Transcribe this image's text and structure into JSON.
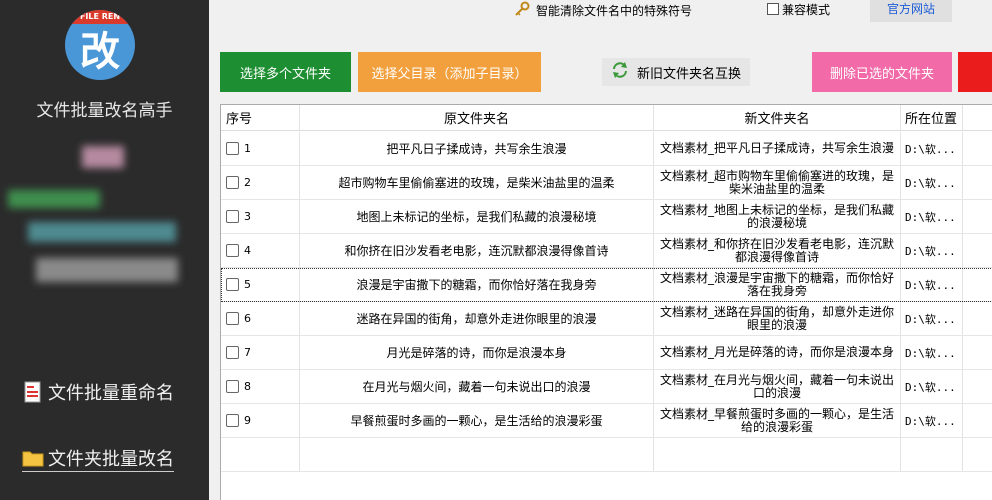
{
  "sidebar": {
    "logo_top_text": "FILE REN",
    "logo_char": "改",
    "app_title": "文件批量改名高手",
    "nav_rename": "文件批量重命名",
    "nav_folder": "文件夹批量改名"
  },
  "topbar": {
    "clear_special": "智能清除文件名中的特殊符号",
    "compat_mode": "兼容模式",
    "official_site": "官方网站"
  },
  "buttons": {
    "select_multi": "选择多个文件夹",
    "select_parent": "选择父目录（添加子目录）",
    "swap": "新旧文件夹名互换",
    "delete_selected": "删除已选的文件夹"
  },
  "table": {
    "headers": [
      "序号",
      "原文件夹名",
      "新文件夹名",
      "所在位置"
    ],
    "rows": [
      {
        "idx": "1",
        "orig": "把平凡日子揉成诗，共写余生浪漫",
        "new": "文档素材_把平凡日子揉成诗，共写余生浪漫",
        "loc": "D:\\软..."
      },
      {
        "idx": "2",
        "orig": "超市购物车里偷偷塞进的玫瑰，是柴米油盐里的温柔",
        "new": "文档素材_超市购物车里偷偷塞进的玫瑰，是柴米油盐里的温柔",
        "loc": "D:\\软..."
      },
      {
        "idx": "3",
        "orig": "地图上未标记的坐标，是我们私藏的浪漫秘境",
        "new": "文档素材_地图上未标记的坐标，是我们私藏的浪漫秘境",
        "loc": "D:\\软..."
      },
      {
        "idx": "4",
        "orig": "和你挤在旧沙发看老电影，连沉默都浪漫得像首诗",
        "new": "文档素材_和你挤在旧沙发看老电影，连沉默都浪漫得像首诗",
        "loc": "D:\\软..."
      },
      {
        "idx": "5",
        "orig": "浪漫是宇宙撒下的糖霜，而你恰好落在我身旁",
        "new": "文档素材_浪漫是宇宙撒下的糖霜，而你恰好落在我身旁",
        "loc": "D:\\软..."
      },
      {
        "idx": "6",
        "orig": "迷路在异国的街角，却意外走进你眼里的浪漫",
        "new": "文档素材_迷路在异国的街角，却意外走进你眼里的浪漫",
        "loc": "D:\\软..."
      },
      {
        "idx": "7",
        "orig": "月光是碎落的诗，而你是浪漫本身",
        "new": "文档素材_月光是碎落的诗，而你是浪漫本身",
        "loc": "D:\\软..."
      },
      {
        "idx": "8",
        "orig": "在月光与烟火间，藏着一句未说出口的浪漫",
        "new": "文档素材_在月光与烟火间，藏着一句未说出口的浪漫",
        "loc": "D:\\软..."
      },
      {
        "idx": "9",
        "orig": "早餐煎蛋时多画的一颗心，是生活给的浪漫彩蛋",
        "new": "文档素材_早餐煎蛋时多画的一颗心，是生活给的浪漫彩蛋",
        "loc": "D:\\软..."
      }
    ]
  },
  "colors": {
    "sidebar_bg": "#2b2b2b",
    "btn_green": "#1e8e32",
    "btn_orange": "#f2a03d",
    "btn_pink": "#f26ba8",
    "btn_red": "#ea1c1c",
    "link_blue": "#1a5bd6"
  },
  "icons": [
    "key-icon",
    "refresh-swap-icon",
    "document-icon",
    "folder-icon"
  ]
}
